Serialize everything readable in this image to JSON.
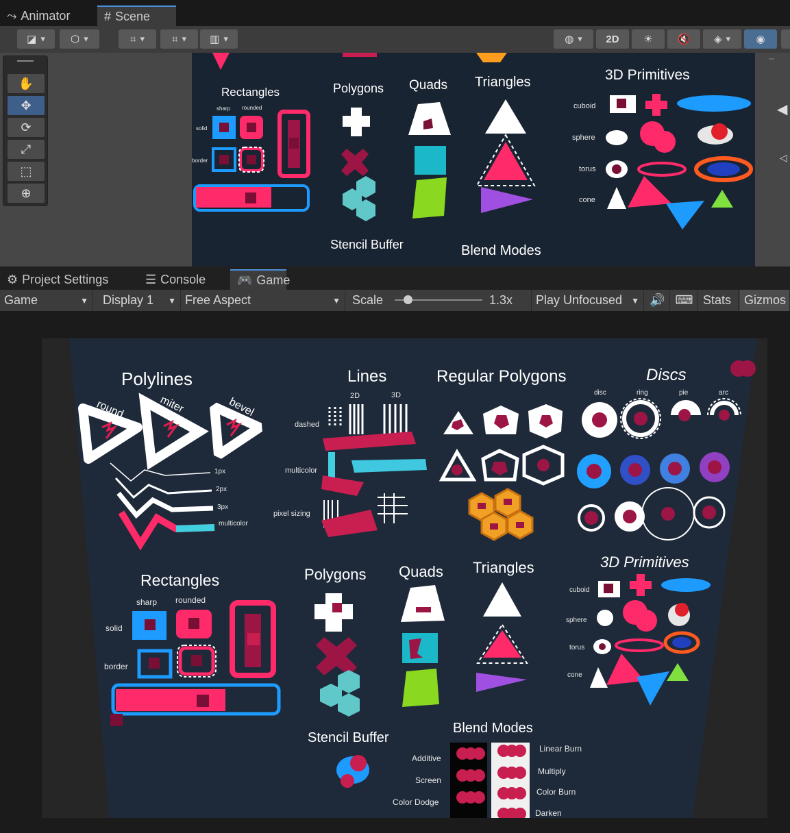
{
  "top_tabs": [
    {
      "label": "Animator",
      "icon": "animator-icon"
    },
    {
      "label": "Scene",
      "icon": "hash-icon"
    }
  ],
  "scene_toolbar": {
    "mode_2d_label": "2D"
  },
  "scene": {
    "titles": {
      "rectangles": "Rectangles",
      "polygons": "Polygons",
      "quads": "Quads",
      "triangles": "Triangles",
      "primitives": "3D Primitives",
      "stencil": "Stencil Buffer",
      "blend": "Blend Modes"
    },
    "rect_labels": {
      "sharp": "sharp",
      "rounded": "rounded",
      "solid": "solid",
      "border": "border"
    },
    "prim_labels": [
      "cuboid",
      "sphere",
      "torus",
      "cone"
    ]
  },
  "bottom_tabs": [
    {
      "label": "Project Settings",
      "icon": "gear-icon"
    },
    {
      "label": "Console",
      "icon": "console-icon"
    },
    {
      "label": "Game",
      "icon": "gamepad-icon"
    }
  ],
  "game_toolbar": {
    "game_label": "Game",
    "display_label": "Display 1",
    "aspect_label": "Free Aspect",
    "scale_label": "Scale",
    "scale_value": "1.3x",
    "scale_fraction": 0.15,
    "play_label": "Play Unfocused",
    "stats_label": "Stats",
    "gizmos_label": "Gizmos"
  },
  "game": {
    "titles": {
      "polylines": "Polylines",
      "lines": "Lines",
      "regular_polygons": "Regular Polygons",
      "discs": "Discs",
      "rectangles": "Rectangles",
      "polygons": "Polygons",
      "quads": "Quads",
      "triangles": "Triangles",
      "primitives": "3D Primitives",
      "stencil": "Stencil Buffer",
      "blend": "Blend Modes"
    },
    "polyline_joins": [
      "round",
      "miter",
      "bevel"
    ],
    "polyline_widths": [
      "1px",
      "2px",
      "3px",
      "multicolor"
    ],
    "lines_cols": [
      "2D",
      "3D"
    ],
    "lines_rows": [
      "dashed",
      "multicolor",
      "pixel sizing"
    ],
    "disc_types": [
      "disc",
      "ring",
      "pie",
      "arc"
    ],
    "rect_labels": {
      "sharp": "sharp",
      "rounded": "rounded",
      "solid": "solid",
      "border": "border"
    },
    "prim_labels": [
      "cuboid",
      "sphere",
      "torus",
      "cone"
    ],
    "blend_left": [
      "Additive",
      "Screen",
      "Color Dodge"
    ],
    "blend_right": [
      "Linear Burn",
      "Multiply",
      "Color Burn",
      "Darken"
    ]
  }
}
